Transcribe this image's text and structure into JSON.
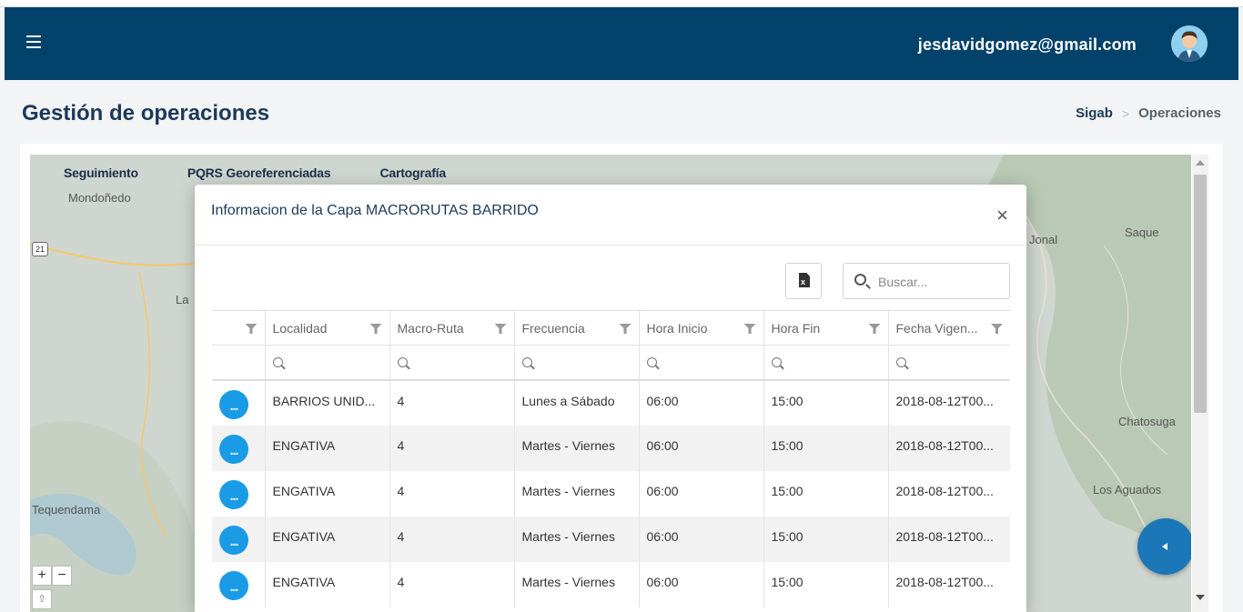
{
  "header": {
    "user_email": "jesdavidgomez@gmail.com"
  },
  "page": {
    "title": "Gestión de operaciones",
    "breadcrumb": {
      "root": "Sigab",
      "current": "Operaciones"
    }
  },
  "map": {
    "tabs": [
      "Seguimiento",
      "PQRS Georeferenciadas",
      "Cartografía"
    ],
    "labels": {
      "mondonedo": "Mondoñedo",
      "la": "La",
      "tequendama": "Tequendama",
      "jonal": "Jonal",
      "saque": "Saque",
      "chatosuga": "Chatosuga",
      "los_aguados": "Los Aguados"
    },
    "route_shield": "21",
    "zoom_in": "+",
    "zoom_out": "−",
    "north": "⇧",
    "colors": {
      "land": "#cfd6cf",
      "water": "#9fc3d9",
      "road": "#f6c66a",
      "forest": "#b9c9b5"
    }
  },
  "modal": {
    "title": "Informacion de la Capa MACRORUTAS BARRIDO",
    "close": "×",
    "export_icon": "excel-file-icon",
    "export_glyph": "x",
    "search_placeholder": "Buscar...",
    "columns": [
      "",
      "Localidad",
      "Macro-Ruta",
      "Frecuencia",
      "Hora Inicio",
      "Hora Fin",
      "Fecha Vigen..."
    ],
    "row_action": "...",
    "rows": [
      [
        "BARRIOS UNID...",
        "4",
        "Lunes a Sábado",
        "06:00",
        "15:00",
        "2018-08-12T00..."
      ],
      [
        "ENGATIVA",
        "4",
        "Martes - Viernes",
        "06:00",
        "15:00",
        "2018-08-12T00..."
      ],
      [
        "ENGATIVA",
        "4",
        "Martes - Viernes",
        "06:00",
        "15:00",
        "2018-08-12T00..."
      ],
      [
        "ENGATIVA",
        "4",
        "Martes - Viernes",
        "06:00",
        "15:00",
        "2018-08-12T00..."
      ],
      [
        "ENGATIVA",
        "4",
        "Martes - Viernes",
        "06:00",
        "15:00",
        "2018-08-12T00..."
      ]
    ],
    "colors": {
      "action_button": "#1a9be6",
      "alt_row": "#f2f2f2"
    }
  },
  "colors": {
    "header": "#03426b",
    "title": "#1b3a59",
    "fab": "#1b77b8"
  }
}
